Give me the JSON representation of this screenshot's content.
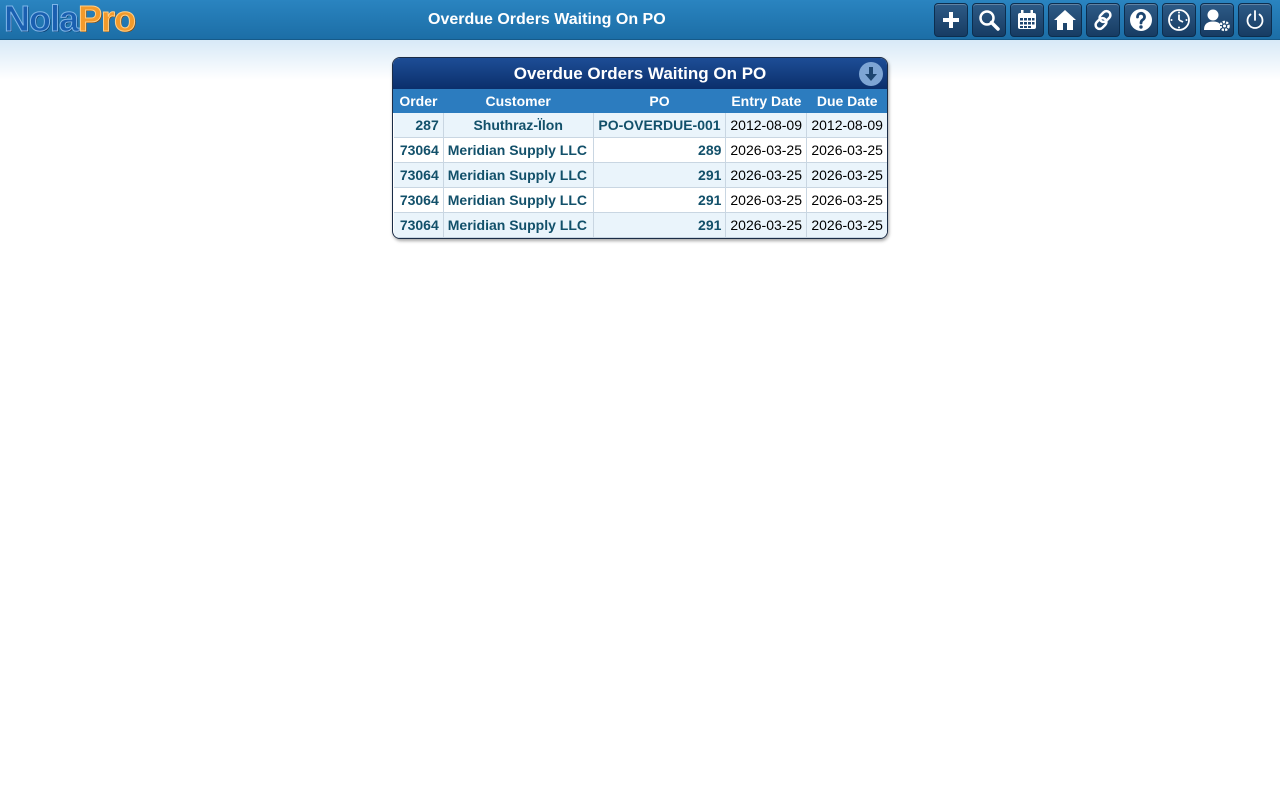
{
  "app": {
    "logo_part1": "Nola",
    "logo_part2": "Pro",
    "title": "Overdue Orders Waiting On PO"
  },
  "toolbar": [
    {
      "icon": "plus-icon"
    },
    {
      "icon": "search-icon"
    },
    {
      "icon": "calendar-icon"
    },
    {
      "icon": "home-icon"
    },
    {
      "icon": "link-icon"
    },
    {
      "icon": "help-icon"
    },
    {
      "icon": "clock-icon"
    },
    {
      "icon": "user-settings-icon"
    },
    {
      "icon": "power-icon"
    }
  ],
  "report": {
    "title": "Overdue Orders Waiting On PO",
    "columns": {
      "order": "Order",
      "customer": "Customer",
      "po": "PO",
      "entry_date": "Entry Date",
      "due_date": "Due Date"
    },
    "rows": [
      {
        "order": "287",
        "customer": "Shuthraz-Ïlon",
        "po": "PO-OVERDUE-001",
        "entry_date": "2012-08-09",
        "due_date": "2012-08-09"
      },
      {
        "order": "73064",
        "customer": "Meridian Supply LLC",
        "po": "289",
        "entry_date": "2026-03-25",
        "due_date": "2026-03-25"
      },
      {
        "order": "73064",
        "customer": "Meridian Supply LLC",
        "po": "291",
        "entry_date": "2026-03-25",
        "due_date": "2026-03-25"
      },
      {
        "order": "73064",
        "customer": "Meridian Supply LLC",
        "po": "291",
        "entry_date": "2026-03-25",
        "due_date": "2026-03-25"
      },
      {
        "order": "73064",
        "customer": "Meridian Supply LLC",
        "po": "291",
        "entry_date": "2026-03-25",
        "due_date": "2026-03-25"
      }
    ]
  },
  "colors": {
    "topbar": "#2a84c0",
    "panel_header": "#0b2f6b",
    "table_header": "#2c7cbf",
    "link_text": "#12506a",
    "alt_row": "#eaf4fb"
  }
}
